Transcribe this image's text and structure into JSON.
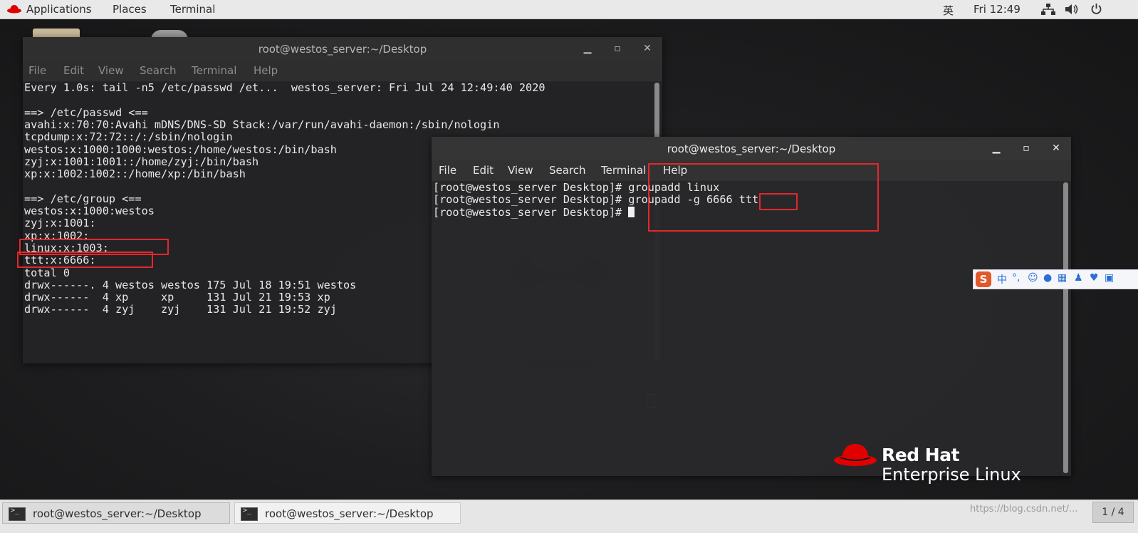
{
  "topbar": {
    "applications": "Applications",
    "places": "Places",
    "terminal": "Terminal",
    "input_method": "英",
    "clock": "Fri 12:49"
  },
  "terminal1": {
    "title": "root@westos_server:~/Desktop",
    "menu": [
      "File",
      "Edit",
      "View",
      "Search",
      "Terminal",
      "Help"
    ],
    "lines": [
      "Every 1.0s: tail -n5 /etc/passwd /et...  westos_server: Fri Jul 24 12:49:40 2020",
      "",
      "==> /etc/passwd <==",
      "avahi:x:70:70:Avahi mDNS/DNS-SD Stack:/var/run/avahi-daemon:/sbin/nologin",
      "tcpdump:x:72:72::/:/sbin/nologin",
      "westos:x:1000:1000:westos:/home/westos:/bin/bash",
      "zyj:x:1001:1001::/home/zyj:/bin/bash",
      "xp:x:1002:1002::/home/xp:/bin/bash",
      "",
      "==> /etc/group <==",
      "westos:x:1000:westos",
      "zyj:x:1001:",
      "xp:x:1002:",
      "linux:x:1003:",
      "ttt:x:6666:",
      "total 0",
      "drwx------. 4 westos westos 175 Jul 18 19:51 westos",
      "drwx------  4 xp     xp     131 Jul 21 19:53 xp",
      "drwx------  4 zyj    zyj    131 Jul 21 19:52 zyj"
    ]
  },
  "terminal2": {
    "title": "root@westos_server:~/Desktop",
    "menu": [
      "File",
      "Edit",
      "View",
      "Search",
      "Terminal",
      "Help"
    ],
    "lines": [
      "[root@westos_server Desktop]# groupadd linux",
      "[root@westos_server Desktop]# groupadd -g 6666 ttt",
      "[root@westos_server Desktop]# "
    ]
  },
  "ime": {
    "logo": "S",
    "lang": "中"
  },
  "brand": {
    "line1": "Red Hat",
    "line2": "Enterprise Linux"
  },
  "taskbar": {
    "task1": "root@westos_server:~/Desktop",
    "task2": "root@westos_server:~/Desktop",
    "workspace": "1 / 4"
  },
  "watermark": "https://blog.csdn.net/...",
  "colors": {
    "highlight": "#e5272b",
    "redhat": "#e00000"
  }
}
